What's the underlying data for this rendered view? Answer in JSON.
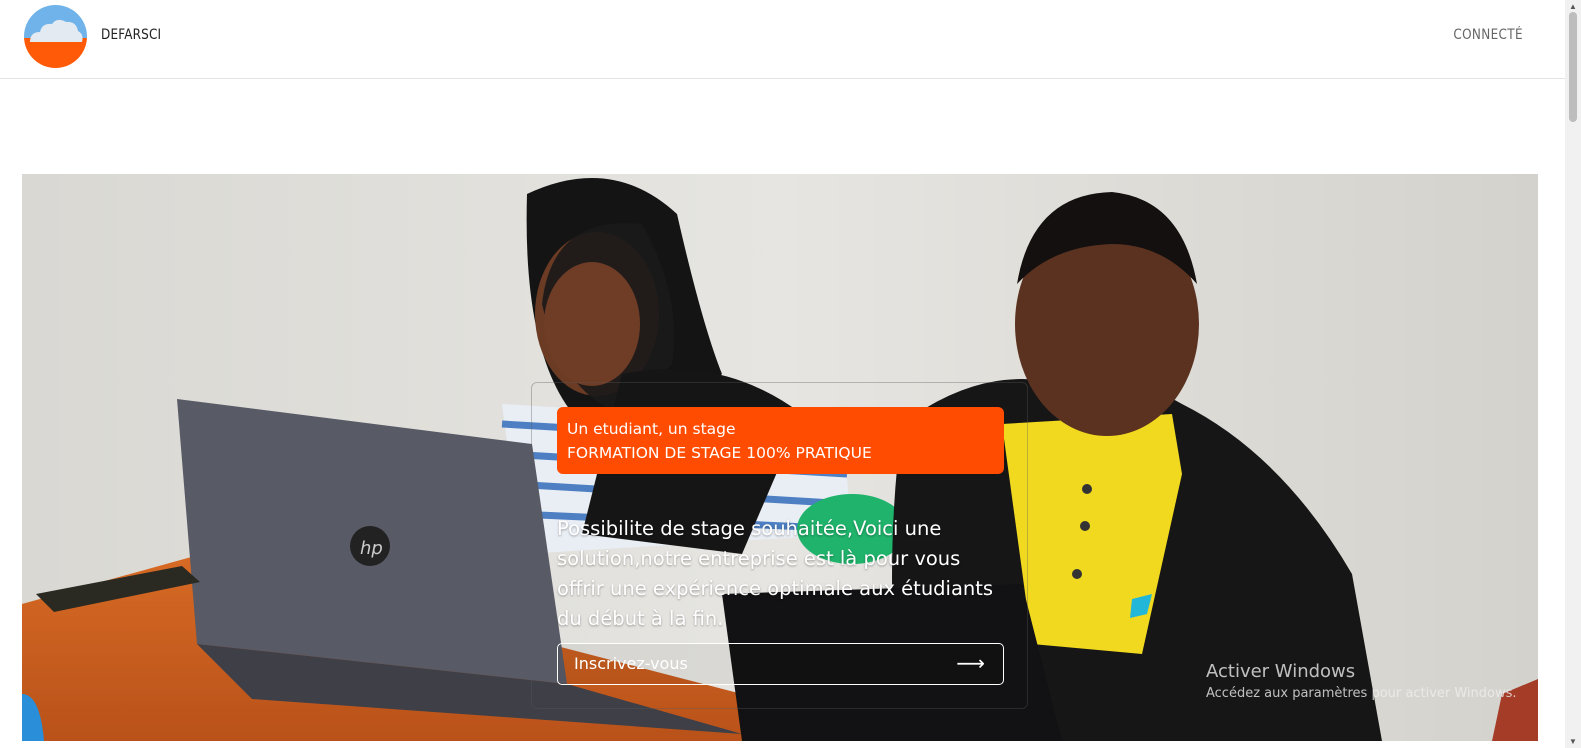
{
  "header": {
    "brand": "DEFARSCI",
    "connect_label": "CONNECTÉ"
  },
  "hero": {
    "tagline": "Un etudiant, un stage",
    "headline": "FORMATION DE STAGE 100% PRATIQUE",
    "description": "Possibilite de stage souhaitée,Voici une solution,notre entreprise est là pour vous offrir une expérience optimale aux étudiants du début à la fin.",
    "cta_label": "Inscrivez-vous",
    "cta_arrow": "⟶"
  },
  "watermark": {
    "title": "Activer Windows",
    "subtitle": "Accédez aux paramètres pour activer Windows."
  },
  "colors": {
    "accent": "#ff4c00",
    "logo_top": "#6fb3ea",
    "logo_bottom": "#ff5a08"
  },
  "icons": {
    "logo": "cloud-logo-icon",
    "cta": "arrow-right-icon"
  }
}
